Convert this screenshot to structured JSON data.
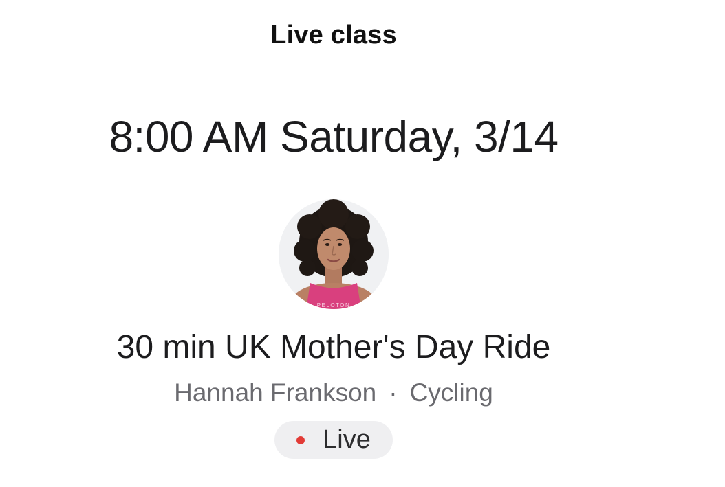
{
  "header": {
    "title": "Live class"
  },
  "class": {
    "datetime": "8:00 AM Saturday, 3/14",
    "title": "30 min UK Mother's Day Ride",
    "instructor": "Hannah Frankson",
    "separator": "·",
    "discipline": "Cycling",
    "status_label": "Live"
  },
  "avatar": {
    "shirt_text": "PELOTON"
  },
  "colors": {
    "live_dot": "#e23b36",
    "badge_bg": "#efeff1",
    "shirt": "#d9407e"
  },
  "icons": {
    "live_indicator": "red-dot-icon"
  }
}
